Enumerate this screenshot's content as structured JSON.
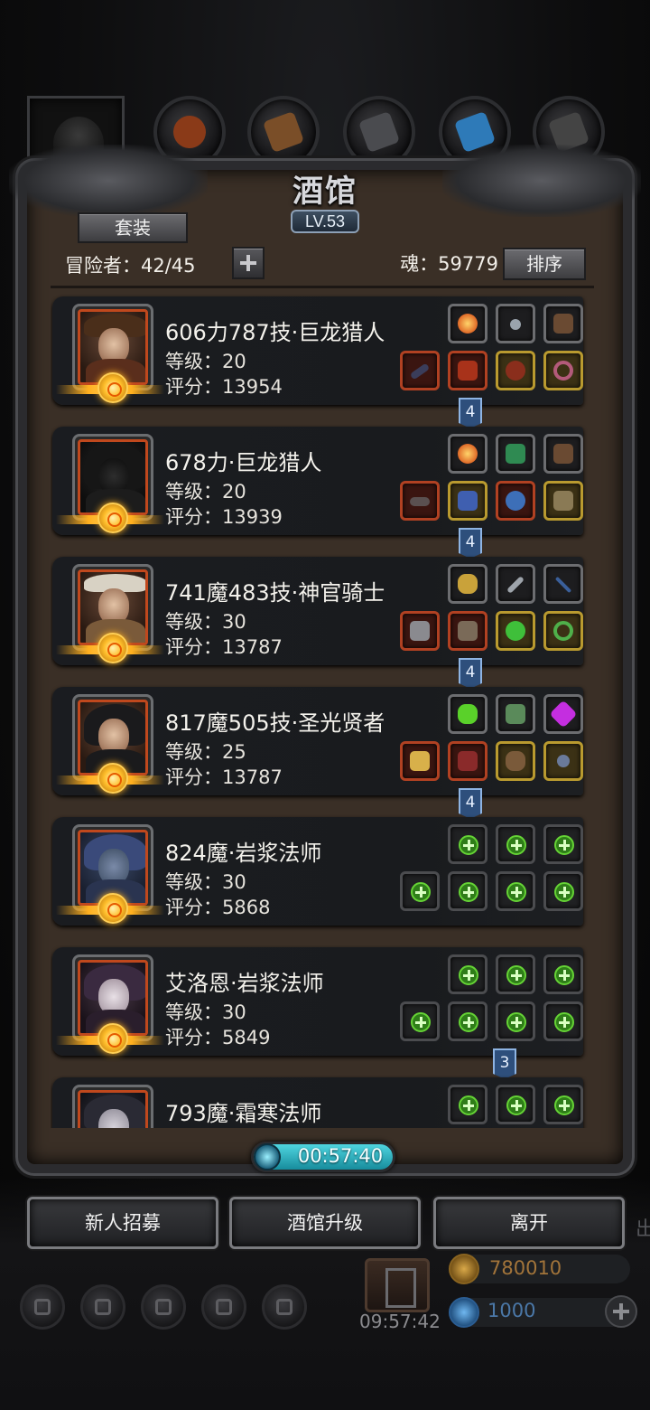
{
  "title": "酒馆",
  "level": "LV.53",
  "suit_button": "套装",
  "adventurers": "冒险者：42/45",
  "soul": "魂：59779",
  "sort_button": "排序",
  "heroes": [
    {
      "name": "606力787技·巨龙猎人",
      "level": "等级：20",
      "score": "评分：13954",
      "link": "4",
      "equipped": true
    },
    {
      "name": "678力·巨龙猎人",
      "level": "等级：20",
      "score": "评分：13939",
      "link": "4",
      "equipped": true
    },
    {
      "name": "741魔483技·神官骑士",
      "level": "等级：30",
      "score": "评分：13787",
      "link": "4",
      "equipped": true
    },
    {
      "name": "817魔505技·圣光贤者",
      "level": "等级：25",
      "score": "评分：13787",
      "link": "4",
      "equipped": true
    },
    {
      "name": "824魔·岩浆法师",
      "level": "等级：30",
      "score": "评分：5868",
      "link": "",
      "equipped": false
    },
    {
      "name": "艾洛恩·岩浆法师",
      "level": "等级：30",
      "score": "评分：5849",
      "link": "3",
      "equipped": false
    },
    {
      "name": "793魔·霜寒法师",
      "level": "",
      "score": "",
      "link": "",
      "equipped": false
    }
  ],
  "timer": "00:57:40",
  "buttons": {
    "recruit": "新人招募",
    "upgrade": "酒馆升级",
    "leave": "离开"
  },
  "side_label": "出",
  "gift_timer": "09:57:42",
  "gold": "780010",
  "gems": "1000",
  "colors": {
    "frame_wood": "#3a2f26",
    "card_bg": "#1a1c20",
    "timer_cyan": "#4fd5e0",
    "link_blue": "#2e4f7c",
    "rank_gold": "#ffbf2c"
  }
}
